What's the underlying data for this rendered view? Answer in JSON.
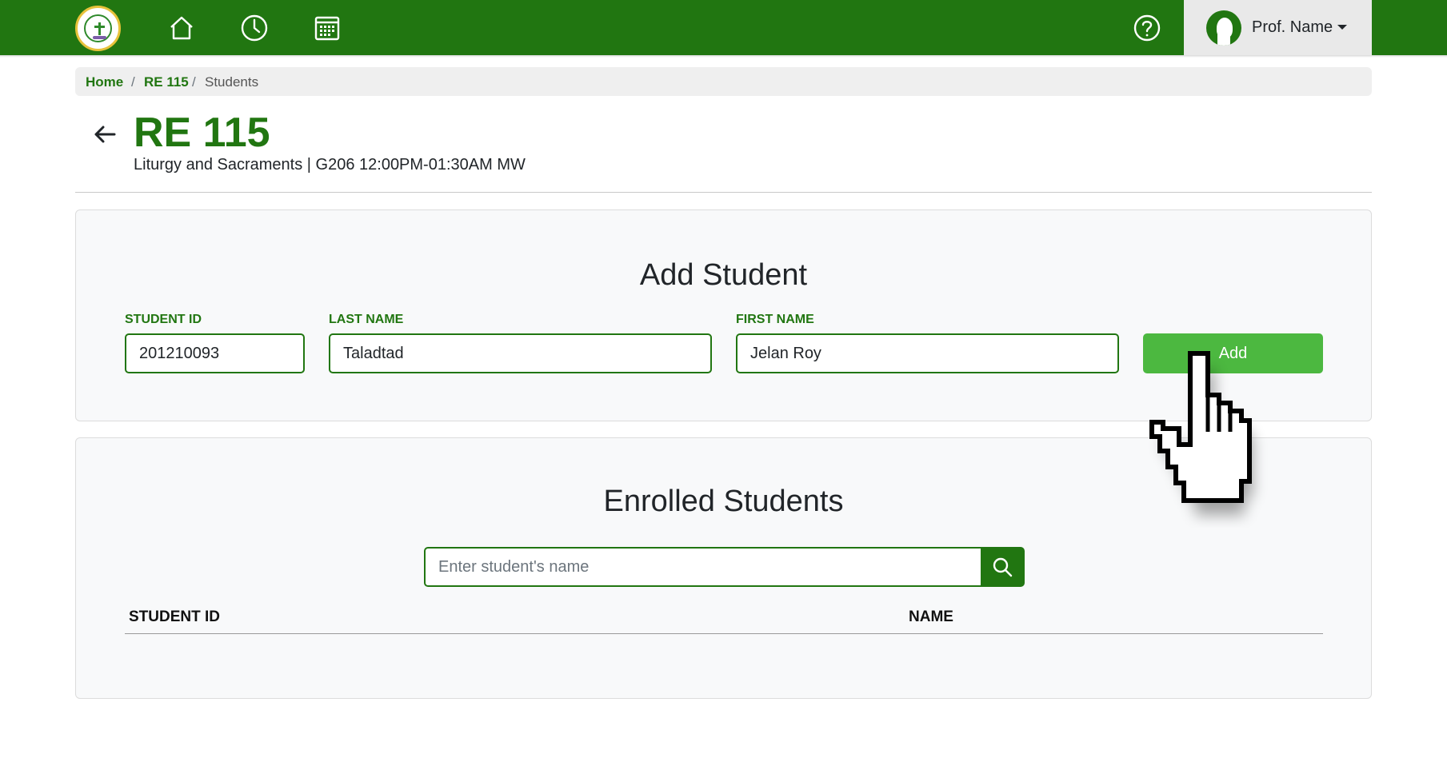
{
  "navbar": {
    "logo": "school-seal-logo",
    "icons": [
      "home-icon",
      "clock-icon",
      "calendar-icon"
    ],
    "help_icon": "help-icon",
    "profile_name": "Prof. Name",
    "color": "#217611"
  },
  "breadcrumb": {
    "home": "Home",
    "sep1": "/",
    "course": "RE 115",
    "sep2": "/",
    "current": "Students"
  },
  "course": {
    "code": "RE 115",
    "subtitle": "Liturgy and Sacraments | G206 12:00PM-01:30AM MW"
  },
  "add_student": {
    "title": "Add Student",
    "student_id_label": "STUDENT ID",
    "student_id_value": "201210093",
    "last_name_label": "LAST NAME",
    "last_name_value": "Taladtad",
    "first_name_label": "FIRST NAME",
    "first_name_value": "Jelan Roy",
    "add_button": "Add",
    "button_color": "#4cb840"
  },
  "enrolled": {
    "title": "Enrolled Students",
    "search_placeholder": "Enter student's name",
    "columns": [
      "STUDENT ID",
      "NAME"
    ],
    "rows": []
  }
}
